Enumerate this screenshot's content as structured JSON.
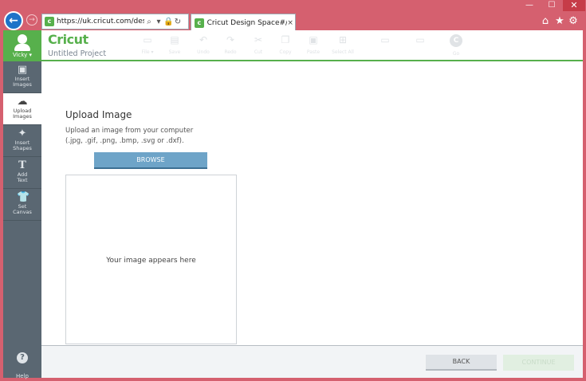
{
  "browser": {
    "url": "https://uk.cricut.com/design/#/",
    "tab_title": "Cricut Design Space#/landi...",
    "tab_close": "×",
    "window_controls": {
      "minimize": "—",
      "maximize": "☐",
      "close": "✕"
    }
  },
  "app": {
    "logo": "Cricut",
    "project_title": "Untitled Project"
  },
  "user": {
    "name": "Vicky ▾"
  },
  "sidebar": {
    "items": [
      {
        "label_1": "Insert",
        "label_2": "Images"
      },
      {
        "label_1": "Upload",
        "label_2": "Images"
      },
      {
        "label_1": "Insert",
        "label_2": "Shapes"
      },
      {
        "label_1": "Add",
        "label_2": "Text"
      },
      {
        "label_1": "Set",
        "label_2": "Canvas"
      }
    ],
    "help": "Help"
  },
  "toolbar": {
    "file": "File ▾",
    "save": "Save",
    "undo": "Undo",
    "redo": "Redo",
    "cut": "Cut",
    "copy": "Copy",
    "paste": "Paste",
    "select_all": "Select All",
    "go": "Go"
  },
  "upload": {
    "title": "Upload Image",
    "desc_line1": "Upload an image from your computer",
    "desc_line2": "(.jpg, .gif, .png, .bmp, .svg or .dxf).",
    "browse": "BROWSE",
    "placeholder": "Your image appears here"
  },
  "footer": {
    "back": "BACK",
    "continue": "CONTINUE"
  },
  "colors": {
    "chrome": "#d5606f",
    "brand_green": "#57b04c",
    "sidebar": "#5a6772",
    "browse_blue": "#6ea4c8"
  }
}
